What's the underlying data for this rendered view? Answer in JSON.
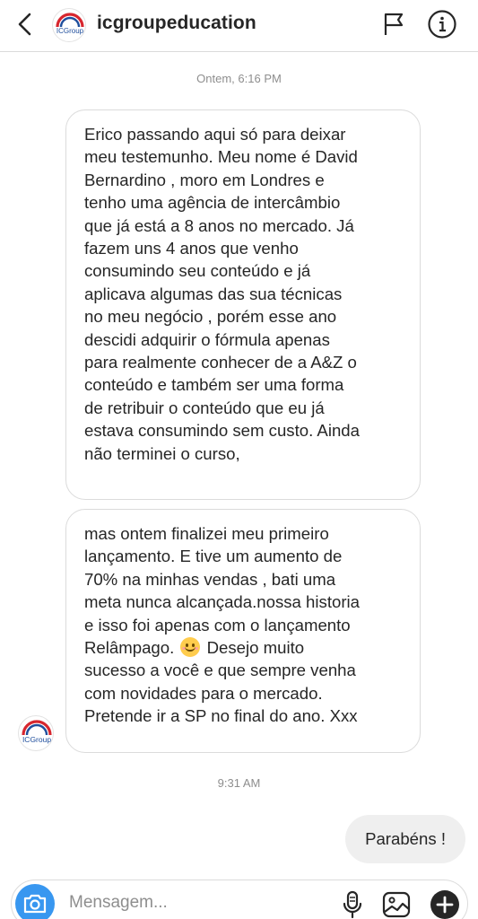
{
  "header": {
    "username": "icgroupeducation",
    "avatar_text": "ICGroup",
    "back_icon": "chevron-left-icon",
    "flag_icon": "flag-icon",
    "info_icon": "info-icon"
  },
  "thread": {
    "timestamp_1": "Ontem, 6:16 PM",
    "message_1_lines": [
      "Erico passando aqui só para deixar",
      "meu testemunho. Meu nome é David",
      "Bernardino , moro em Londres e",
      "tenho uma agência de intercâmbio",
      "que já está a 8 anos no mercado. Já",
      "fazem uns 4 anos que venho",
      "consumindo seu conteúdo e já",
      "aplicava algumas das sua técnicas",
      "no meu negócio , porém esse ano",
      "descidi adquirir o fórmula apenas",
      "para realmente  conhecer de a A&Z o",
      "conteúdo e também ser uma forma",
      "de retribuir o conteúdo que eu já",
      "estava consumindo sem custo. Ainda",
      "não terminei o curso,"
    ],
    "message_2": {
      "lines_a": [
        "mas ontem finalizei meu primeiro",
        "lançamento. E tive um aumento  de",
        "70% na minhas vendas , bati uma",
        "meta nunca alcançada.nossa historia",
        "e isso foi apenas com o lançamento"
      ],
      "line_emoji_before": "Relâmpago.",
      "emoji_name": "smiling-face-emoji",
      "line_emoji_after": "Desejo muito",
      "lines_b": [
        "sucesso a você e que sempre venha",
        "com novidades para o mercado.",
        "Pretende ir a SP no final do ano. Xxx"
      ]
    },
    "timestamp_2": "9:31 AM",
    "reply": "Parabéns !"
  },
  "composer": {
    "placeholder": "Mensagem...",
    "camera_icon": "camera-icon",
    "mic_icon": "microphone-icon",
    "gallery_icon": "image-icon",
    "plus_icon": "plus-icon"
  },
  "colors": {
    "accent": "#3897f0",
    "text": "#262626",
    "muted": "#8e8e8e",
    "border": "#dbdbdb",
    "outgoing_bubble": "#efefef",
    "logo_red": "#d7262e",
    "logo_blue": "#1f4e9c"
  }
}
